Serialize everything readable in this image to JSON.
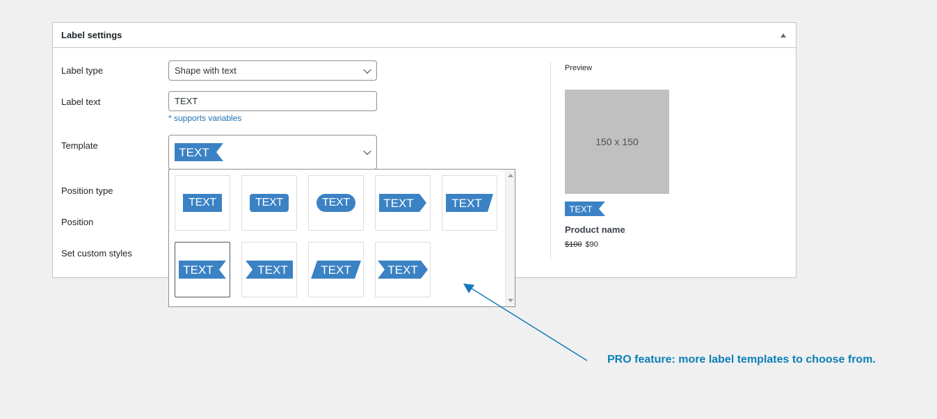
{
  "panel": {
    "title": "Label settings"
  },
  "form": {
    "label_type": {
      "label": "Label type",
      "value": "Shape with text"
    },
    "label_text": {
      "label": "Label text",
      "value": "TEXT",
      "hint": "* supports variables"
    },
    "template": {
      "label": "Template",
      "selected_text": "TEXT"
    },
    "position_type": {
      "label": "Position type"
    },
    "position": {
      "label": "Position"
    },
    "custom_styles": {
      "label": "Set custom styles"
    }
  },
  "templates": [
    {
      "text": "TEXT",
      "shape": "rectangle"
    },
    {
      "text": "TEXT",
      "shape": "rounded"
    },
    {
      "text": "TEXT",
      "shape": "pill"
    },
    {
      "text": "TEXT",
      "shape": "arrow-right"
    },
    {
      "text": "TEXT",
      "shape": "slanted-right"
    },
    {
      "text": "TEXT",
      "shape": "ribbon-right",
      "selected": true
    },
    {
      "text": "TEXT",
      "shape": "ribbon-left"
    },
    {
      "text": "TEXT",
      "shape": "parallelogram"
    },
    {
      "text": "TEXT",
      "shape": "arrow-both"
    }
  ],
  "preview": {
    "heading": "Preview",
    "placeholder": "150 x 150",
    "label_text": "TEXT",
    "product_name": "Product name",
    "old_price": "$100",
    "new_price": "$90"
  },
  "annotation": {
    "text": "PRO feature: more label templates to choose from."
  },
  "colors": {
    "label_blue": "#3b82c4",
    "annotation_blue": "#0b7fb5",
    "link_blue": "#2271b1"
  }
}
